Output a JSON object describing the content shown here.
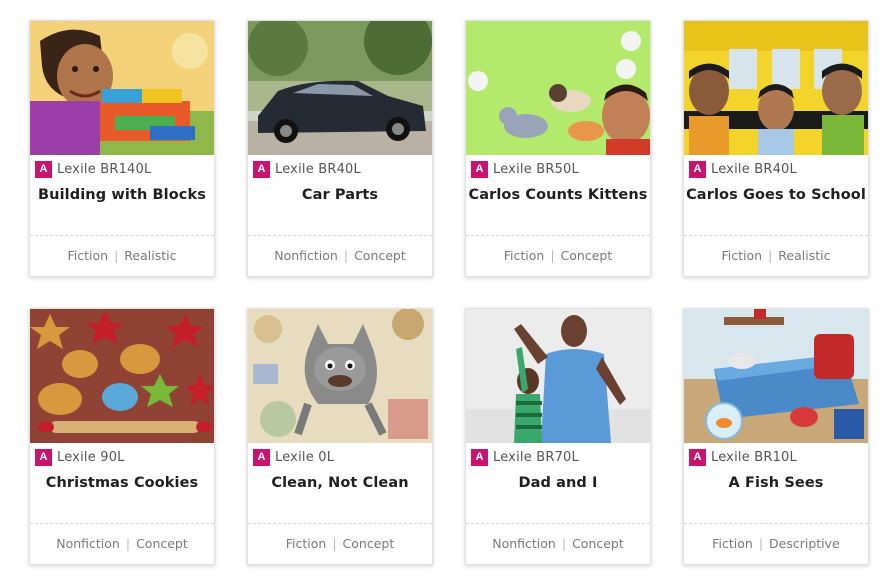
{
  "books": [
    {
      "level_badge": "A",
      "lexile": "Lexile BR140L",
      "title": "Building with Blocks",
      "genre": "Fiction",
      "subgenre": "Realistic"
    },
    {
      "level_badge": "A",
      "lexile": "Lexile BR40L",
      "title": "Car Parts",
      "genre": "Nonfiction",
      "subgenre": "Concept"
    },
    {
      "level_badge": "A",
      "lexile": "Lexile BR50L",
      "title": "Carlos Counts Kittens",
      "genre": "Fiction",
      "subgenre": "Concept"
    },
    {
      "level_badge": "A",
      "lexile": "Lexile BR40L",
      "title": "Carlos Goes to School",
      "genre": "Fiction",
      "subgenre": "Realistic"
    },
    {
      "level_badge": "A",
      "lexile": "Lexile 90L",
      "title": "Christmas Cookies",
      "genre": "Nonfiction",
      "subgenre": "Concept"
    },
    {
      "level_badge": "A",
      "lexile": "Lexile 0L",
      "title": "Clean, Not Clean",
      "genre": "Fiction",
      "subgenre": "Concept"
    },
    {
      "level_badge": "A",
      "lexile": "Lexile BR70L",
      "title": "Dad and I",
      "genre": "Nonfiction",
      "subgenre": "Concept"
    },
    {
      "level_badge": "A",
      "lexile": "Lexile BR10L",
      "title": "A Fish Sees",
      "genre": "Fiction",
      "subgenre": "Descriptive"
    }
  ],
  "tag_separator": "|",
  "colors": {
    "badge": "#c8146e",
    "title": "#1f1f1f",
    "tags": "#7a7a7a"
  }
}
